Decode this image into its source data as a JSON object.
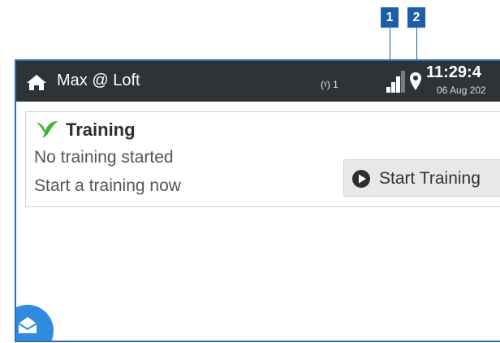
{
  "callouts": [
    "1",
    "2"
  ],
  "header": {
    "title": "Max @ Loft",
    "antenna_label": "(ᵞ) 1",
    "time": "11:29:4",
    "date": "06 Aug 202",
    "icons": {
      "home": "home-icon",
      "signal": "signal-icon",
      "location": "location-pin-icon"
    }
  },
  "training_card": {
    "title": "Training",
    "status_line": "No training started",
    "hint_line": "Start a training now",
    "button_label": "Start Training",
    "icons": {
      "title": "bird-icon",
      "button": "play-icon"
    }
  },
  "fab": {
    "icon": "mail-icon"
  },
  "colors": {
    "topbar": "#2e3338",
    "accent_green": "#3cb43c",
    "callout_blue": "#1a5fa8",
    "fab_blue": "#2f8ae0"
  }
}
